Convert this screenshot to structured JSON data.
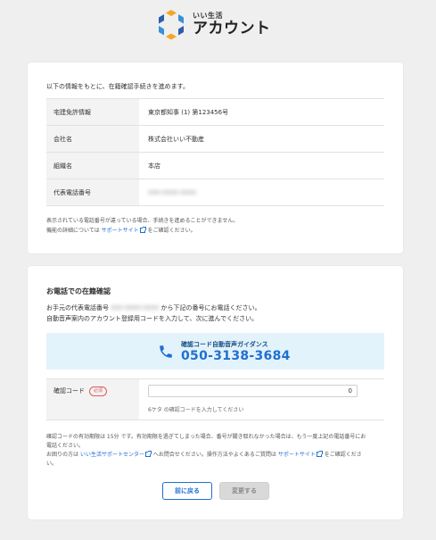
{
  "logo": {
    "small": "いい生活",
    "big": "アカウント"
  },
  "info": {
    "intro": "以下の情報をもとに、在籍確認手続きを進めます。",
    "rows": [
      {
        "label": "宅建免許情報",
        "value": "東京都知事 (1) 第123456号"
      },
      {
        "label": "会社名",
        "value": "株式会社いい不動産"
      },
      {
        "label": "組織名",
        "value": "本店"
      },
      {
        "label": "代表電話番号",
        "value": "000-0000-0000"
      }
    ],
    "note1": "表示されている電話番号が違っている場合、手続きを進めることができません。",
    "note2_pre": "機能の詳細については",
    "note2_link": "サポートサイト",
    "note2_post": "をご確認ください。"
  },
  "phone": {
    "title": "お電話での在籍確認",
    "line1_pre": "お手元の代表電話番号",
    "line1_blurred": "000-0000-0000",
    "line1_post": "から下記の番号にお電話ください。",
    "line2": "自動音声案内のアカウント登録用コードを入力して、次に進んでください。",
    "guide_label": "確認コード自動音声ガイダンス",
    "guide_number": "050-3138-3684",
    "code_label": "確認コード",
    "required_badge": "必須",
    "code_value": "0",
    "code_hint": "6ケタ の確認コードを入力してください",
    "note1": "確認コードの有効期限は 15分 です。有効期限を過ぎてしまった場合、番号が聞き取れなかった場合は、もう一度上記の電話番号にお",
    "note2": "電話ください。",
    "note3_pre": "お困りの方は",
    "note3_link1": "いい生活サポートセンター",
    "note3_mid": "へお問合せください。操作方法やよくあるご質問は",
    "note3_link2": "サポートサイト",
    "note3_post": "をご確認くださ",
    "note4": "い。",
    "back_button": "前に戻る",
    "change_button": "変更する"
  },
  "colors": {
    "accent": "#1f6fd1",
    "guide_bg": "#e3f3fb",
    "required": "#e05a5a"
  }
}
